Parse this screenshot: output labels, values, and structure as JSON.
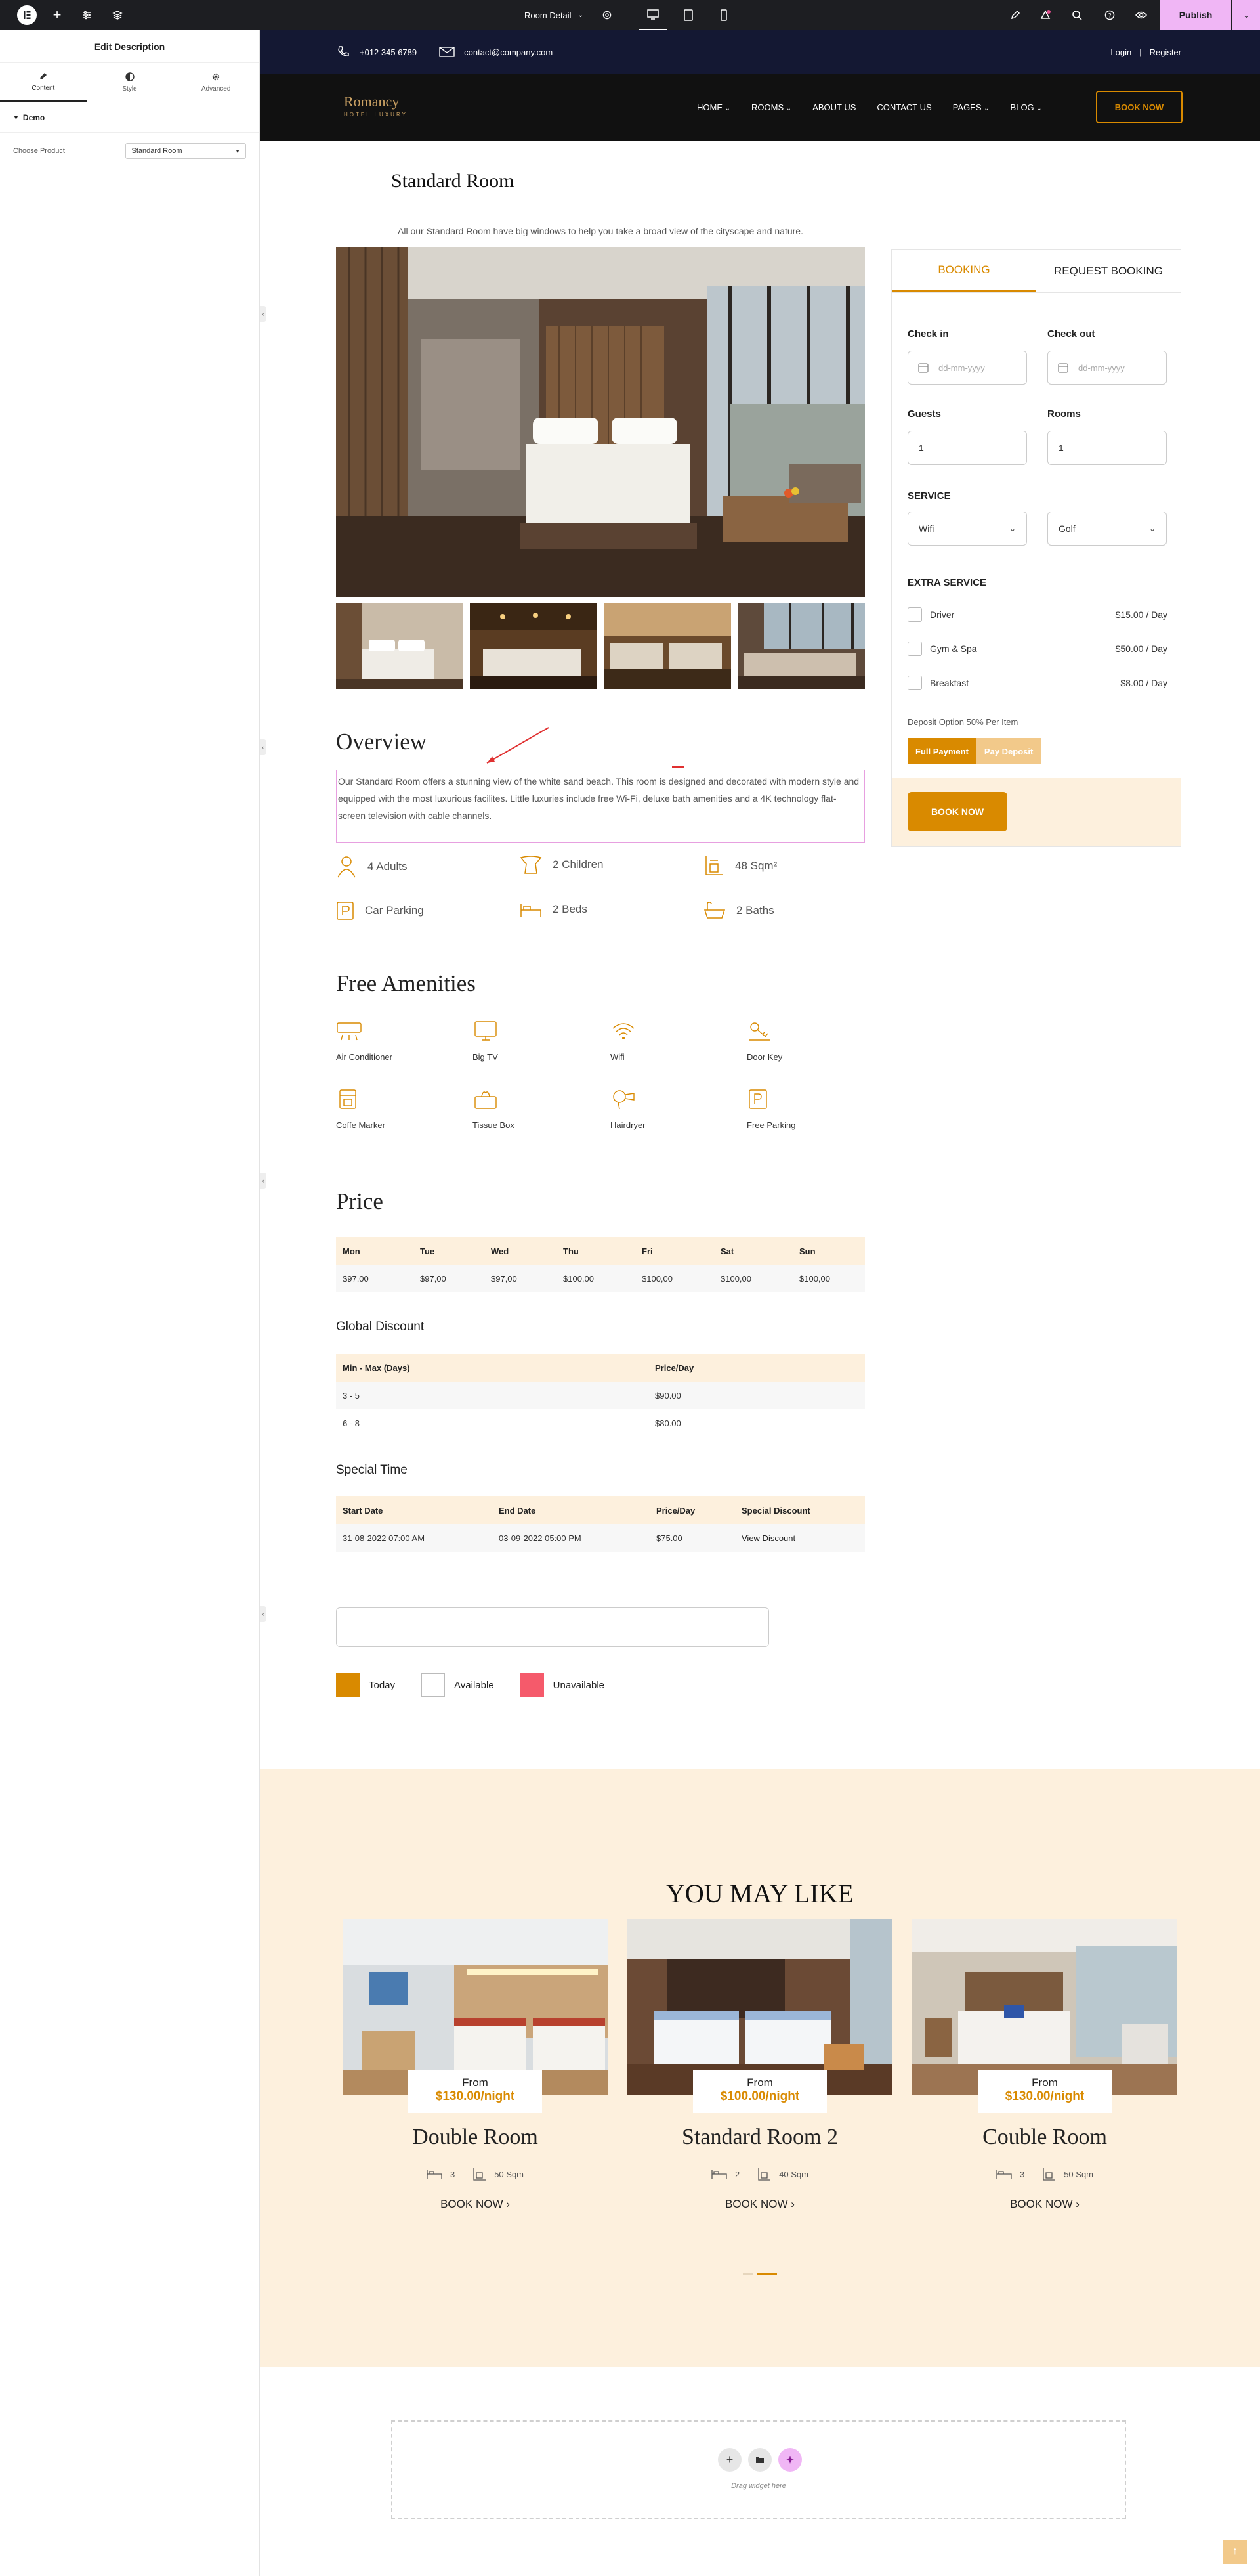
{
  "editor": {
    "publish_label": "Publish",
    "page_selector": "Room Detail",
    "panel_title": "Edit Description",
    "tabs": [
      {
        "label": "Content",
        "icon": "pencil-icon"
      },
      {
        "label": "Style",
        "icon": "half-circle-icon"
      },
      {
        "label": "Advanced",
        "icon": "gear-icon"
      }
    ],
    "section_title": "Demo",
    "choose_product_label": "Choose Product",
    "choose_product_value": "Standard Room",
    "drag_widget_text": "Drag widget here"
  },
  "site": {
    "phone": "+012 345 6789",
    "email": "contact@company.com",
    "login": "Login",
    "register": "Register",
    "logo_name": "Romancy",
    "logo_sub": "HOTEL LUXURY",
    "nav": [
      "HOME",
      "ROOMS",
      "ABOUT US",
      "CONTACT US",
      "PAGES",
      "BLOG"
    ],
    "book_now": "BOOK NOW"
  },
  "room": {
    "title": "Standard Room",
    "tagline": "All our Standard Room have big windows to help you take a broad view of the cityscape and nature.",
    "overview_title": "Overview",
    "overview_text": "Our Standard Room offers a stunning view of the white sand beach. This room is designed and decorated with modern style and equipped with the most luxurious facilites. Little luxuries include free Wi-Fi, deluxe bath amenities and a 4K technology flat-screen television with cable channels.",
    "features": [
      "4 Adults",
      "2 Children",
      "48 Sqm²",
      "Car Parking",
      "2 Beds",
      "2 Baths"
    ],
    "amenities_title": "Free Amenities",
    "amenities": [
      "Air Conditioner",
      "Big TV",
      "Wifi",
      "Door Key",
      "Coffe Marker",
      "Tissue Box",
      "Hairdryer",
      "Free Parking"
    ],
    "price_title": "Price",
    "price_days": [
      "Mon",
      "Tue",
      "Wed",
      "Thu",
      "Fri",
      "Sat",
      "Sun"
    ],
    "price_values": [
      "$97,00",
      "$97,00",
      "$97,00",
      "$100,00",
      "$100,00",
      "$100,00",
      "$100,00"
    ],
    "discount_title": "Global Discount",
    "discount_headers": [
      "Min - Max (Days)",
      "Price/Day"
    ],
    "discount_rows": [
      [
        "3 - 5",
        "$90.00"
      ],
      [
        "6 - 8",
        "$80.00"
      ]
    ],
    "special_title": "Special Time",
    "special_headers": [
      "Start Date",
      "End Date",
      "Price/Day",
      "Special Discount"
    ],
    "special_row": [
      "31-08-2022 07:00 AM",
      "03-09-2022 05:00 PM",
      "$75.00",
      "View Discount"
    ],
    "legend": [
      "Today",
      "Available",
      "Unavailable"
    ]
  },
  "booking": {
    "tab_booking": "BOOKING",
    "tab_request": "REQUEST BOOKING",
    "check_in": "Check in",
    "check_out": "Check out",
    "date_placeholder": "dd-mm-yyyy",
    "guests_label": "Guests",
    "rooms_label": "Rooms",
    "guests_value": "1",
    "rooms_value": "1",
    "service_label": "SERVICE",
    "service_1": "Wifi",
    "service_2": "Golf",
    "extra_label": "EXTRA SERVICE",
    "extras": [
      {
        "name": "Driver",
        "price": "$15.00 / Day"
      },
      {
        "name": "Gym & Spa",
        "price": "$50.00 / Day"
      },
      {
        "name": "Breakfast",
        "price": "$8.00 / Day"
      }
    ],
    "deposit_text": "Deposit Option 50% Per Item",
    "full_payment": "Full Payment",
    "pay_deposit": "Pay Deposit",
    "book_now": "BOOK NOW"
  },
  "related": {
    "title": "YOU MAY LIKE",
    "rooms": [
      {
        "name": "Double Room",
        "from": "From",
        "price": "$130.00/night",
        "beds": "3",
        "size": "50 Sqm",
        "cta": "BOOK NOW"
      },
      {
        "name": "Standard Room 2",
        "from": "From",
        "price": "$100.00/night",
        "beds": "2",
        "size": "40 Sqm",
        "cta": "BOOK NOW"
      },
      {
        "name": "Couble Room",
        "from": "From",
        "price": "$130.00/night",
        "beds": "3",
        "size": "50 Sqm",
        "cta": "BOOK NOW"
      }
    ]
  },
  "colors": {
    "accent": "#d98a00",
    "topbar": "#1d1e22",
    "header": "#111",
    "cream": "#fdf0dd",
    "unavailable": "#f55a6b",
    "publish_bg": "#f0b6f5"
  }
}
